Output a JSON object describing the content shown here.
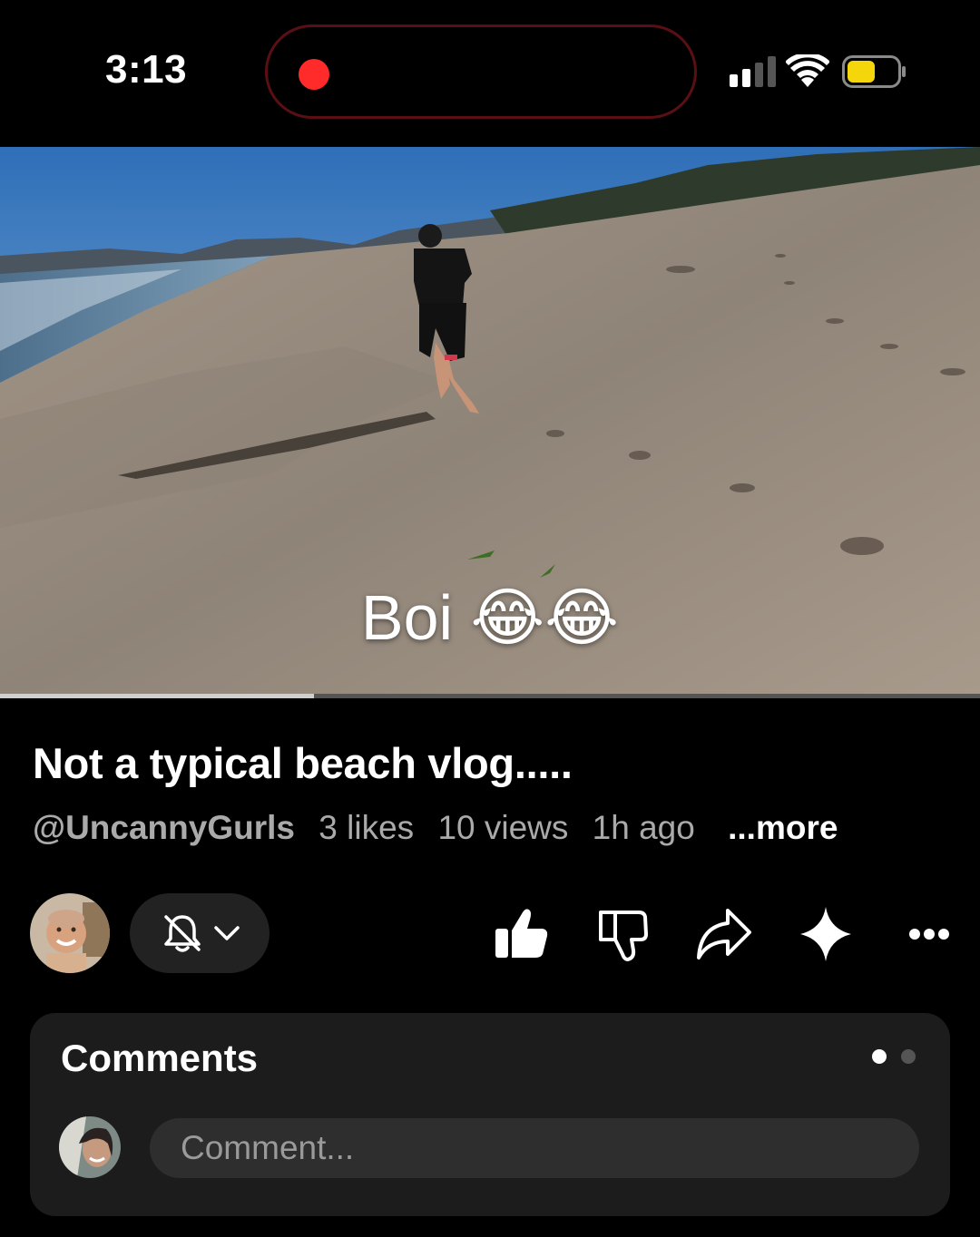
{
  "status_bar": {
    "time": "3:13",
    "recording_color": "#ff2a2a",
    "battery_color": "#f5d60a"
  },
  "video": {
    "caption": "Boi 😂😂",
    "progress": 0.32
  },
  "info": {
    "title": "Not a typical beach vlog.....",
    "channel": "@UncannyGurls",
    "likes": "3 likes",
    "views": "10 views",
    "time_ago": "1h ago",
    "more": "...more"
  },
  "actions": {
    "icons": [
      "avatar",
      "bell-off-icon",
      "chevron-down-icon",
      "thumbs-up-icon",
      "thumbs-down-icon",
      "share-icon",
      "sparkle-icon",
      "more-icon"
    ]
  },
  "comments": {
    "title": "Comments",
    "placeholder": "Comment..."
  }
}
